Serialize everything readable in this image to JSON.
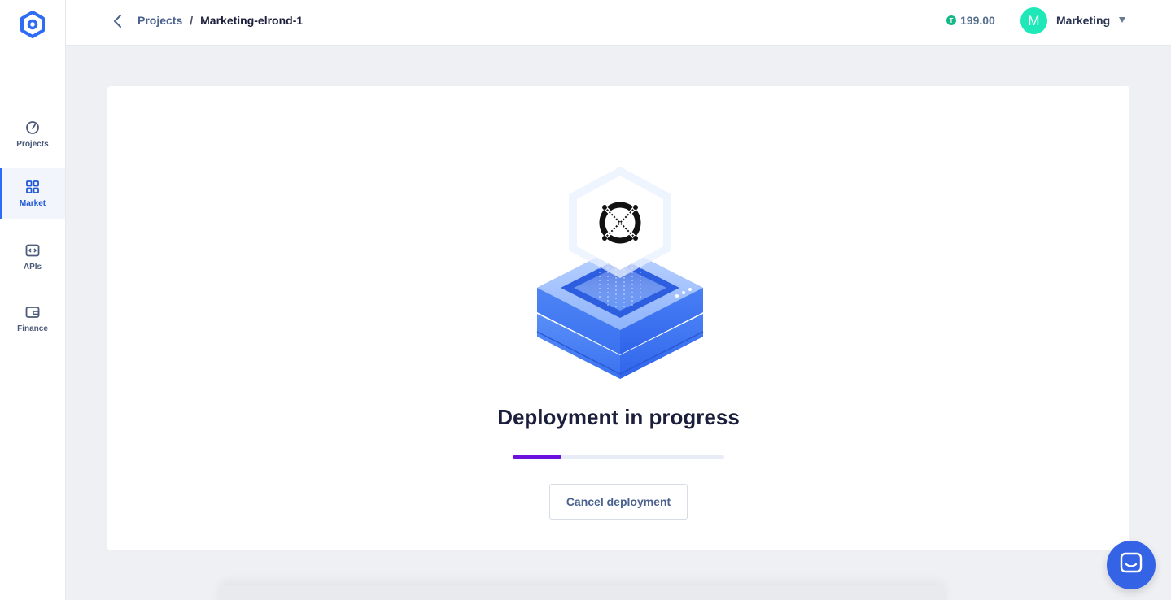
{
  "sidebar": {
    "items": [
      {
        "label": "Projects",
        "icon": "speedometer-icon"
      },
      {
        "label": "Market",
        "icon": "grid-icon",
        "active": true
      },
      {
        "label": "APIs",
        "icon": "code-icon"
      },
      {
        "label": "Finance",
        "icon": "wallet-icon"
      }
    ]
  },
  "header": {
    "breadcrumb_parent": "Projects",
    "breadcrumb_separator": "/",
    "breadcrumb_current": "Marketing-elrond-1",
    "balance_icon": "T",
    "balance": "199.00",
    "avatar_initial": "M",
    "account_name": "Marketing"
  },
  "main": {
    "title": "Deployment in progress",
    "progress_fraction": 0.23,
    "cancel_label": "Cancel deployment"
  },
  "colors": {
    "accent": "#2e6cf6",
    "progress": "#6a11e0",
    "avatar": "#1ee8b8",
    "chat": "#3463e6"
  }
}
